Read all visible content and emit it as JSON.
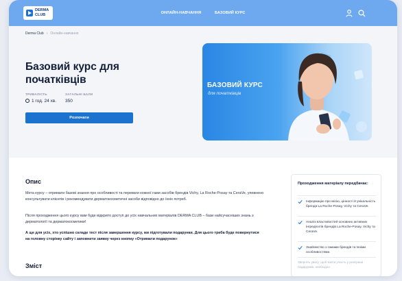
{
  "header": {
    "logo_line1": "DERMA",
    "logo_line2": "CLUB",
    "nav": [
      "ОНЛАЙН-НАВЧАННЯ",
      "БАЗОВИЙ КУРС"
    ]
  },
  "breadcrumb": {
    "home": "Derma Club",
    "current": "Онлайн-навчання"
  },
  "course": {
    "title": "Базовий курс для початківців",
    "duration_label": "ТРИВАЛІСТЬ",
    "duration_value": "1 год. 24 хв.",
    "points_label": "ЗАГАЛЬНІ БАЛИ",
    "points_value": "350",
    "start_button": "Розпочати"
  },
  "banner": {
    "title": "БАЗОВИЙ КУРС",
    "subtitle": "для початківців"
  },
  "description": {
    "heading": "Опис",
    "paragraph1": "Мета курсу – отримати базові знання про особливості та переваги кожної гами засобів брендів Vichy, La Roche-Posay та CeraVe, упевнено консультувати клієнтів і рекомендувати дерматокосметичні засоби відповідно до їхніх потреб.",
    "paragraph2": "Після проходження цього курсу вам буде відкрито доступ до усіх навчальних матеріалів DERMA CLUB – бази найсучасніших знань з дерматології та дерматокосметики!",
    "paragraph3": "А ще для усіх, хто успішно складе тест після завершення курсу, ми підготували подарунки. Для цього треба буде повернутися на головну сторінку сайту і заповнити заявку через кнопку «Отримати подарунок»",
    "next_heading": "Зміст"
  },
  "sidebar_card": {
    "title": "Проходження матеріалу передбачає:",
    "items": [
      "Інформацію про місію, цінності й унікальність бренда La Roche-Posay, Vichy та CeraVe.",
      "Аналіз властивостей основних активних інгредієнтів брендів La Roche-Posay, Vichy та CeraVe.",
      "Знайомство з гамами брендів та їхніми особливостями."
    ],
    "footer": "Зверніть увагу: щоб взяти участь у розіграші подарунків, необхідно"
  },
  "colors": {
    "topbar": "#6ea9ef",
    "primary_button": "#1b72cf",
    "check": "#1b72cf"
  },
  "icons": [
    "user-icon",
    "search-icon",
    "chevron-right-icon",
    "clock-icon",
    "check-icon",
    "play-icon"
  ]
}
